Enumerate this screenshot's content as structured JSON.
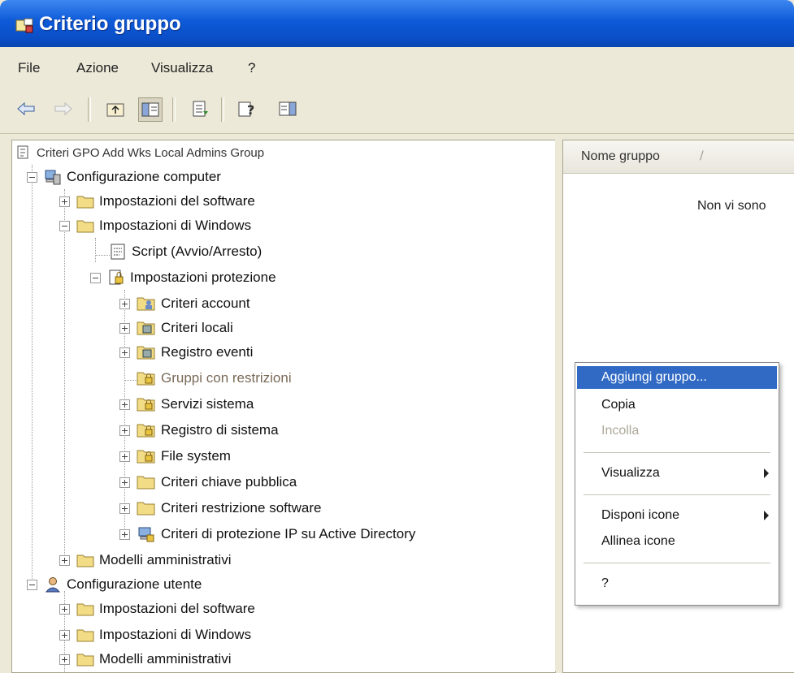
{
  "window": {
    "title": "Criterio gruppo"
  },
  "menubar": {
    "items": [
      "File",
      "Azione",
      "Visualizza",
      "?"
    ]
  },
  "toolbar": {
    "buttons": [
      "back-icon",
      "forward-icon",
      "up-folder-icon",
      "show-hide-tree-icon",
      "export-list-icon",
      "help-icon",
      "show-hide-action-pane-icon"
    ]
  },
  "tree": {
    "root": "Criteri GPO Add Wks Local Admins Group",
    "computer_config": "Configurazione computer",
    "software_settings": "Impostazioni del software",
    "windows_settings": "Impostazioni di Windows",
    "scripts": "Script (Avvio/Arresto)",
    "security_settings": "Impostazioni protezione",
    "account_policies": "Criteri account",
    "local_policies": "Criteri locali",
    "event_log": "Registro eventi",
    "restricted_groups": "Gruppi con restrizioni",
    "system_services": "Servizi sistema",
    "registry": "Registro di sistema",
    "file_system": "File system",
    "public_key_policies": "Criteri chiave pubblica",
    "software_restriction": "Criteri restrizione software",
    "ip_security": "Criteri di protezione IP su Active Directory",
    "admin_templates": "Modelli amministrativi",
    "user_config": "Configurazione utente",
    "user_software_settings": "Impostazioni del software",
    "user_windows_settings": "Impostazioni di Windows",
    "user_admin_templates": "Modelli amministrativi"
  },
  "details": {
    "column_header": "Nome gruppo",
    "sort_indicator": "/",
    "empty_text": "Non vi sono"
  },
  "context_menu": {
    "add_group": "Aggiungi gruppo...",
    "copy": "Copia",
    "paste": "Incolla",
    "view": "Visualizza",
    "arrange_icons": "Disponi icone",
    "line_up_icons": "Allinea icone",
    "help": "?"
  },
  "colors": {
    "titlebar": "#0a4fc8",
    "highlight": "#316ac5",
    "folder": "#f2dc85"
  }
}
